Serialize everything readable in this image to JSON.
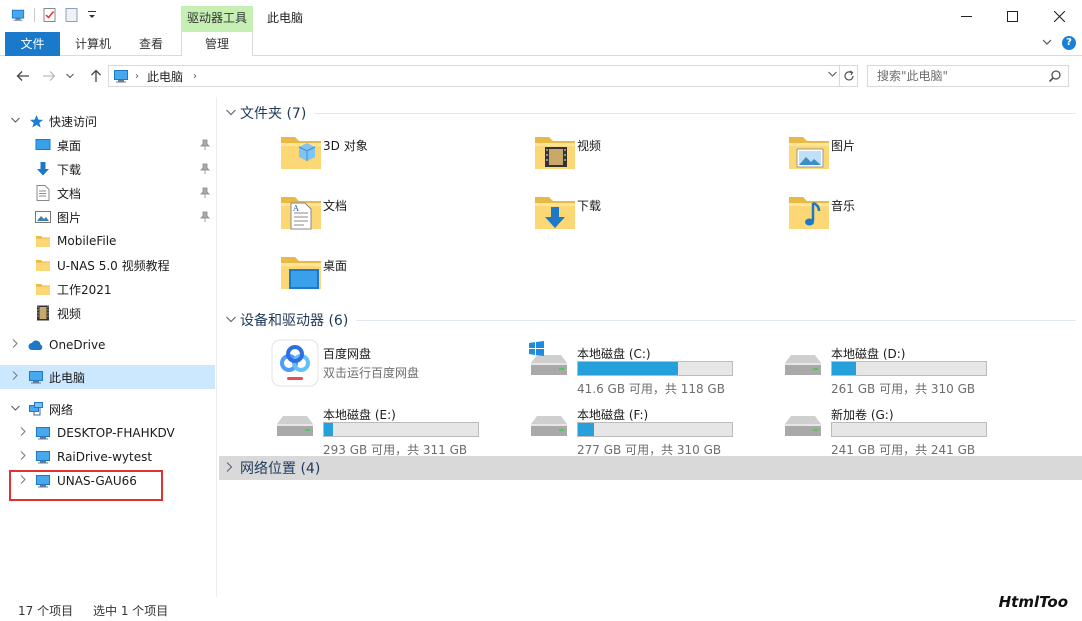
{
  "window": {
    "title": "此电脑",
    "contextual_tab_header": "驱动器工具"
  },
  "ribbon": {
    "tabs": [
      "文件",
      "计算机",
      "查看",
      "管理"
    ]
  },
  "address": {
    "crumb": "此电脑",
    "search_placeholder": "搜索\"此电脑\""
  },
  "sidebar": {
    "quick_access": "快速访问",
    "quick_items": [
      "桌面",
      "下载",
      "文档",
      "图片",
      "MobileFile",
      "U-NAS 5.0 视频教程",
      "工作2021",
      "视频"
    ],
    "onedrive": "OneDrive",
    "this_pc": "此电脑",
    "network": "网络",
    "network_items": [
      "DESKTOP-FHAHKDV",
      "RaiDrive-wytest",
      "UNAS-GAU66"
    ]
  },
  "groups": {
    "folders": "文件夹 (7)",
    "devices": "设备和驱动器 (6)",
    "network": "网络位置 (4)"
  },
  "folders": [
    "3D 对象",
    "视频",
    "图片",
    "文档",
    "下载",
    "音乐",
    "桌面"
  ],
  "app": {
    "name": "百度网盘",
    "subtitle": "双击运行百度网盘"
  },
  "drives": [
    {
      "name": "本地磁盘 (C:)",
      "info": "41.6 GB 可用，共 118 GB",
      "used_fraction": 0.647
    },
    {
      "name": "本地磁盘 (D:)",
      "info": "261 GB 可用，共 310 GB",
      "used_fraction": 0.158
    },
    {
      "name": "本地磁盘 (E:)",
      "info": "293 GB 可用，共 311 GB",
      "used_fraction": 0.058
    },
    {
      "name": "本地磁盘 (F:)",
      "info": "277 GB 可用，共 310 GB",
      "used_fraction": 0.106
    },
    {
      "name": "新加卷 (G:)",
      "info": "241 GB 可用，共 241 GB",
      "used_fraction": 0.0
    }
  ],
  "status": {
    "count": "17 个项目",
    "selected": "选中 1 个项目"
  },
  "watermark": "HtmlToo",
  "colors": {
    "accent": "#1979ca",
    "selected_bg": "#cce8ff",
    "drive_fill": "#26a0da",
    "highlight": "#e0322e",
    "folder": "#f8d775"
  }
}
